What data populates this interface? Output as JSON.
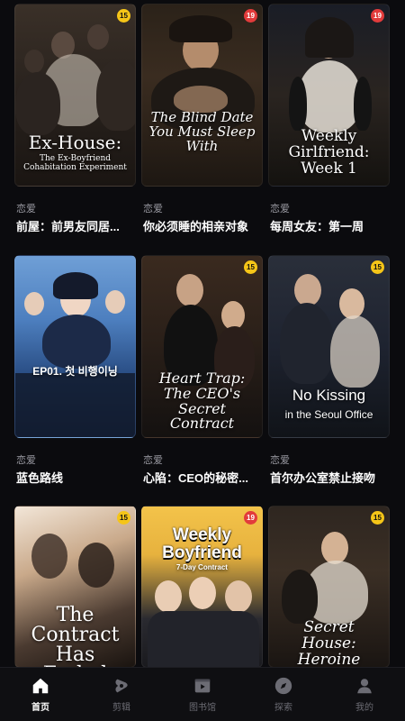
{
  "books": [
    {
      "cover_title": "Ex-House:",
      "cover_sub": "The Ex-Boyfriend Cohabitation Experiment",
      "badge": "15",
      "genre": "恋爱",
      "name": "前屋：前男友同居..."
    },
    {
      "cover_title": "The Blind Date You Must Sleep With",
      "cover_sub": "",
      "badge": "19",
      "genre": "恋爱",
      "name": "你必须睡的相亲对象"
    },
    {
      "cover_title": "Weekly Girlfriend: Week 1",
      "cover_sub": "",
      "badge": "19",
      "genre": "恋爱",
      "name": "每周女友：第一周"
    },
    {
      "cover_title": "EP01. 첫 비행이닝",
      "cover_sub": "",
      "badge": "",
      "genre": "恋爱",
      "name": "蓝色路线"
    },
    {
      "cover_title": "Heart Trap: The CEO's Secret Contract",
      "cover_sub": "",
      "badge": "15",
      "genre": "恋爱",
      "name": "心陷：CEO的秘密..."
    },
    {
      "cover_title": "No Kissing",
      "cover_sub": "in the Seoul Office",
      "badge": "15",
      "genre": "恋爱",
      "name": "首尔办公室禁止接吻"
    },
    {
      "cover_title": "The Contract Has Ended",
      "cover_sub": "",
      "badge": "15",
      "genre": "",
      "name": ""
    },
    {
      "cover_title": "Weekly Boyfriend",
      "cover_sub": "7-Day Contract",
      "badge": "19",
      "genre": "",
      "name": ""
    },
    {
      "cover_title": "Secret House: Heroine Roommates",
      "cover_sub": "",
      "badge": "15",
      "genre": "",
      "name": ""
    }
  ],
  "tabs": [
    {
      "label": "首页",
      "icon": "home-icon"
    },
    {
      "label": "剪辑",
      "icon": "clip-icon"
    },
    {
      "label": "图书馆",
      "icon": "library-icon"
    },
    {
      "label": "探索",
      "icon": "compass-icon"
    },
    {
      "label": "我的",
      "icon": "profile-icon"
    }
  ],
  "colors": {
    "accent": "#ffffff",
    "badge15": "#f5c518",
    "badge19": "#e23b3b",
    "background": "#0b0b0e"
  }
}
